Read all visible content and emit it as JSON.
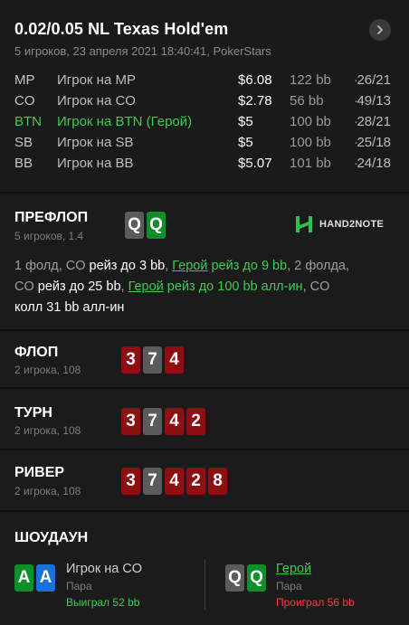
{
  "header": {
    "title": "0.02/0.05 NL Texas Hold'em",
    "subtitle": "5 игроков, 23 апреля 2021 18:40:41, PokerStars"
  },
  "players": [
    {
      "pos": "MP",
      "name": "Игрок на MP",
      "stack": "$6.08",
      "bb": "122 bb",
      "dot": "·",
      "stat": "26/21",
      "hero": false
    },
    {
      "pos": "CO",
      "name": "Игрок на CO",
      "stack": "$2.78",
      "bb": "56 bb",
      "dot": "·",
      "stat": "49/13",
      "hero": false
    },
    {
      "pos": "BTN",
      "name": "Игрок на BTN (Герой)",
      "stack": "$5",
      "bb": "100 bb",
      "dot": "·",
      "stat": "28/21",
      "hero": true
    },
    {
      "pos": "SB",
      "name": "Игрок на SB",
      "stack": "$5",
      "bb": "100 bb",
      "dot": "·",
      "stat": "25/18",
      "hero": false
    },
    {
      "pos": "BB",
      "name": "Игрок на BB",
      "stack": "$5.07",
      "bb": "101 bb",
      "dot": "·",
      "stat": "24/18",
      "hero": false
    }
  ],
  "preflop": {
    "title": "ПРЕФЛОП",
    "sub": "5 игроков, 1.4",
    "hero_cards": [
      {
        "rank": "Q",
        "color": "grey"
      },
      {
        "rank": "Q",
        "color": "green"
      }
    ],
    "logo": "HAND2NOTE",
    "actions": {
      "a1": "1 фолд, CO ",
      "a2": "рейз до 3 bb",
      "a3": ", ",
      "a4": "Герой",
      "a5": " рейз до 9 bb",
      "a6": ", 2 фолда,",
      "a7": "CO ",
      "a8": "рейз до 25 bb",
      "a9": ", ",
      "a10": "Герой",
      "a11": " рейз до 100 bb алл-ин",
      "a12": ", CO",
      "a13": "колл 31 bb алл-ин"
    }
  },
  "flop": {
    "title": "ФЛОП",
    "sub": "2 игрока, 108",
    "cards": [
      {
        "rank": "3",
        "color": "red"
      },
      {
        "rank": "7",
        "color": "grey"
      },
      {
        "rank": "4",
        "color": "red"
      }
    ]
  },
  "turn": {
    "title": "ТУРН",
    "sub": "2 игрока, 108",
    "cards": [
      {
        "rank": "3",
        "color": "red"
      },
      {
        "rank": "7",
        "color": "grey"
      },
      {
        "rank": "4",
        "color": "red"
      },
      {
        "rank": "2",
        "color": "red"
      }
    ]
  },
  "river": {
    "title": "РИВЕР",
    "sub": "2 игрока, 108",
    "cards": [
      {
        "rank": "3",
        "color": "red"
      },
      {
        "rank": "7",
        "color": "grey"
      },
      {
        "rank": "4",
        "color": "red"
      },
      {
        "rank": "2",
        "color": "red"
      },
      {
        "rank": "8",
        "color": "red"
      }
    ]
  },
  "showdown": {
    "title": "ШОУДАУН",
    "left": {
      "cards": [
        {
          "rank": "A",
          "color": "green"
        },
        {
          "rank": "A",
          "color": "blue"
        }
      ],
      "name": "Игрок на CO",
      "hand": "Пара",
      "result": "Выиграл 52 bb"
    },
    "right": {
      "cards": [
        {
          "rank": "Q",
          "color": "grey"
        },
        {
          "rank": "Q",
          "color": "green"
        }
      ],
      "name": "Герой",
      "hand": "Пара",
      "result": "Проиграл 56 bb"
    }
  },
  "colors": {
    "hero_green": "#3ccb52",
    "card_red": "#8e0f12",
    "card_grey": "#5b5b5b",
    "card_green": "#0d8f2a",
    "card_blue": "#1a72d8",
    "loss_red": "#ff3b3b"
  },
  "icons": {
    "nav": "chevron-right-icon",
    "logo": "hand2note-logo-icon"
  }
}
